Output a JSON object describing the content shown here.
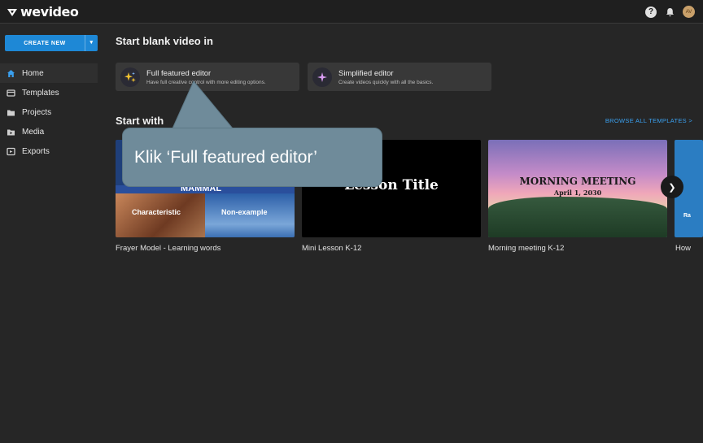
{
  "app": {
    "logo_text": "wevideo"
  },
  "topbar": {
    "help_symbol": "?",
    "avatar_initials": "AV"
  },
  "sidebar": {
    "create_label": "CREATE NEW",
    "items": [
      {
        "label": "Home",
        "icon": "home-icon",
        "active": true
      },
      {
        "label": "Templates",
        "icon": "templates-icon"
      },
      {
        "label": "Projects",
        "icon": "folder-icon"
      },
      {
        "label": "Media",
        "icon": "media-icon"
      },
      {
        "label": "Exports",
        "icon": "exports-icon"
      }
    ]
  },
  "main": {
    "start_blank_heading": "Start blank video in",
    "editors": [
      {
        "title": "Full featured editor",
        "subtitle": "Have full creative control with more editing options."
      },
      {
        "title": "Simplified editor",
        "subtitle": "Create videos quickly with all the basics."
      }
    ],
    "templates_heading": "Start with",
    "browse_label": "BROWSE ALL TEMPLATES >",
    "templates": [
      {
        "label": "Frayer Model - Learning words",
        "thumb_texts": [
          "MAMMAL",
          "Characteristic",
          "Non-example"
        ]
      },
      {
        "label": "Mini Lesson K-12",
        "thumb_texts": [
          "Lesson Title"
        ]
      },
      {
        "label": "Morning meeting K-12",
        "thumb_texts": [
          "MORNING MEETING",
          "April 1, 2030"
        ]
      },
      {
        "label": "How",
        "thumb_texts": [
          "Ra"
        ]
      }
    ]
  },
  "callout": {
    "text": "Klik ‘Full featured editor’"
  },
  "colors": {
    "accent": "#1e88d6",
    "link": "#3aa0ef",
    "callout": "#6f8b9a",
    "background": "#262626"
  }
}
